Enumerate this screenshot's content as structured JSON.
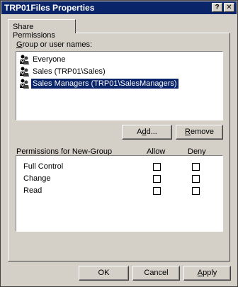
{
  "window": {
    "title": "TRP01Files Properties",
    "help_glyph": "?",
    "close_glyph": "✕"
  },
  "tabs": [
    {
      "label": "Share Permissions"
    }
  ],
  "group_list": {
    "label": "Group or user names:",
    "label_underline": "G",
    "label_rest": "roup or user names:",
    "items": [
      {
        "name": "Everyone",
        "icon": "group-icon",
        "selected": false
      },
      {
        "name": "Sales (TRP01\\Sales)",
        "icon": "group-icon",
        "selected": false
      },
      {
        "name": "Sales Managers (TRP01\\SalesManagers)",
        "icon": "group-icon",
        "selected": true
      }
    ]
  },
  "buttons": {
    "add": "Add...",
    "add_underline": "d",
    "remove": "Remove",
    "remove_underline": "R"
  },
  "permissions": {
    "label": "Permissions for New-Group",
    "allow_header": "Allow",
    "deny_header": "Deny",
    "rows": [
      {
        "name": "Full Control",
        "allow": false,
        "deny": false
      },
      {
        "name": "Change",
        "allow": false,
        "deny": false
      },
      {
        "name": "Read",
        "allow": false,
        "deny": false
      }
    ]
  },
  "dialog_buttons": {
    "ok": "OK",
    "cancel": "Cancel",
    "apply": "Apply",
    "apply_underline": "A"
  },
  "colors": {
    "titlebar": "#0a246a",
    "face": "#d4d0c8",
    "selection": "#0a246a"
  }
}
